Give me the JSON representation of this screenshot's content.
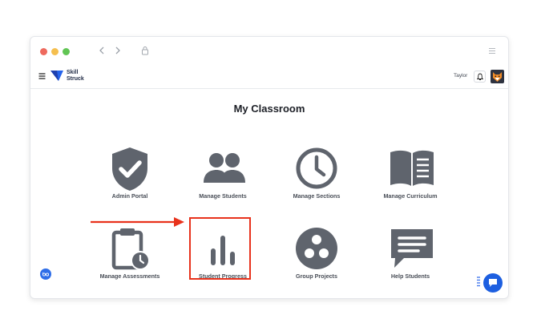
{
  "window": {
    "traffic_lights": [
      "#ee6a5e",
      "#f5bf4f",
      "#61c554"
    ],
    "icons": [
      "chevron-left-icon",
      "chevron-right-icon",
      "lock-icon",
      "menu-icon"
    ]
  },
  "header": {
    "brand": "Skill\nStruck",
    "username": "Taylor",
    "icons": [
      "hamburger-icon",
      "logo-icon",
      "bell-icon",
      "avatar-fox-icon"
    ]
  },
  "main": {
    "title": "My Classroom",
    "tiles": [
      {
        "label": "Admin Portal",
        "icon": "shield-check-icon"
      },
      {
        "label": "Manage Students",
        "icon": "users-icon"
      },
      {
        "label": "Manage Sections",
        "icon": "clock-icon"
      },
      {
        "label": "Manage Curriculum",
        "icon": "book-icon"
      },
      {
        "label": "Manage Assessments",
        "icon": "clipboard-clock-icon"
      },
      {
        "label": "Student Progress",
        "icon": "bar-chart-icon"
      },
      {
        "label": "Group Projects",
        "icon": "group-circle-icon"
      },
      {
        "label": "Help Students",
        "icon": "chat-bubble-icon"
      }
    ]
  },
  "annotation": {
    "highlight_color": "#e8321c",
    "highlighted_tile": "Student Progress"
  },
  "colors": {
    "icon_gray": "#5f646d",
    "accent_blue": "#1d5fe0"
  }
}
